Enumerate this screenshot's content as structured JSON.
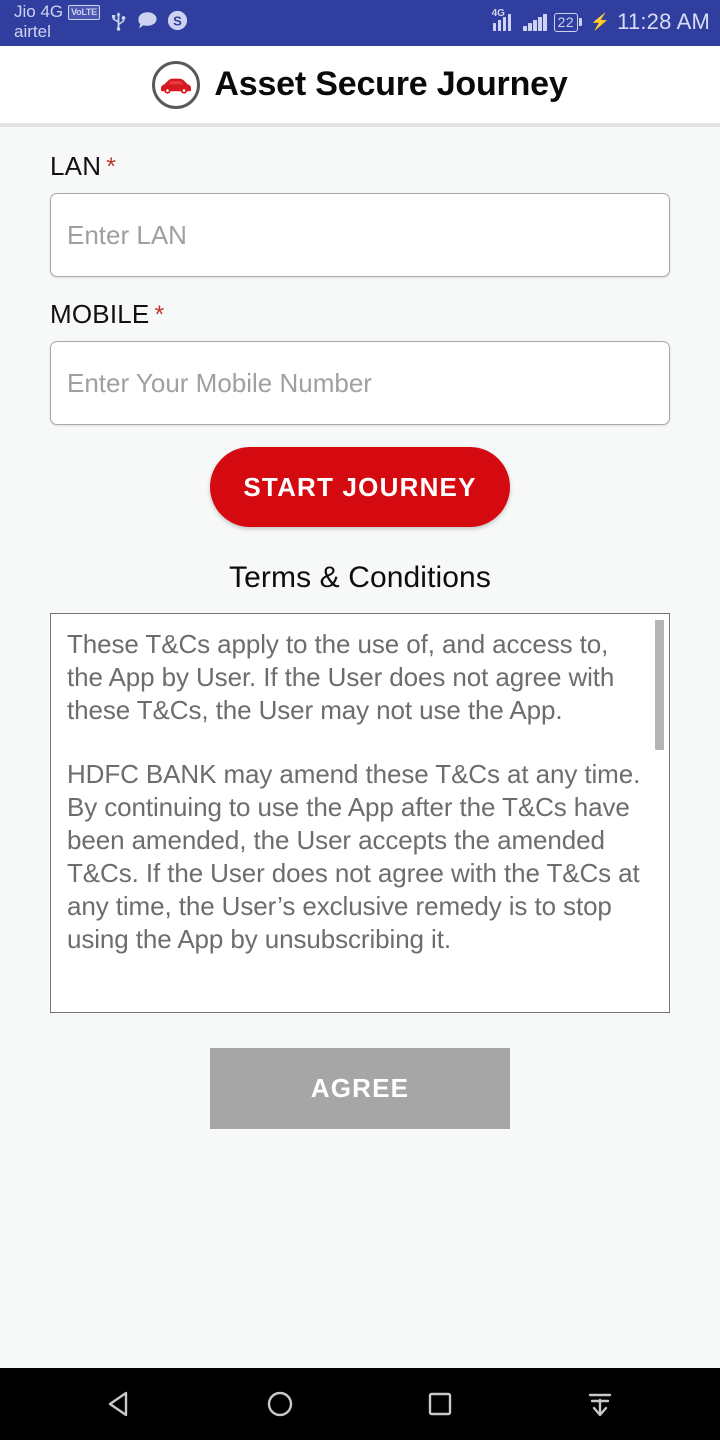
{
  "status_bar": {
    "carrier_primary": "Jio 4G",
    "volte_badge": "VoLTE",
    "carrier_secondary": "airtel",
    "network_label": "4G",
    "battery_percent": "22",
    "charging_glyph": "⚡",
    "time": "11:28 AM",
    "icons": [
      "usb-icon",
      "message-icon",
      "skype-icon",
      "signal-4g-icon",
      "signal-icon",
      "battery-icon",
      "charging-bolt-icon"
    ],
    "background_color": "#303F9F"
  },
  "header": {
    "title": "Asset Secure Journey",
    "logo": "car-circle-logo",
    "background_color": "#FFFFFF"
  },
  "form": {
    "lan": {
      "label": "LAN",
      "required_mark": "*",
      "placeholder": "Enter LAN",
      "value": ""
    },
    "mobile": {
      "label": "MOBILE",
      "required_mark": "*",
      "placeholder": "Enter Your Mobile Number",
      "value": ""
    },
    "start_button": {
      "label": "START JOURNEY",
      "color": "#D50A11"
    }
  },
  "terms": {
    "title": "Terms & Conditions",
    "paragraphs": [
      "These T&Cs apply to the use of, and access to, the App by User. If the User does not agree with these T&Cs, the User may not use the App.",
      " HDFC BANK may amend these T&Cs at any time. By continuing to use the App after the T&Cs have been amended, the User accepts the amended T&Cs. If the User does not agree with the T&Cs at any time, the User’s exclusive remedy is to stop using the App by unsubscribing it."
    ],
    "agree_button": {
      "label": "AGREE",
      "color": "#A6A6A6",
      "state": "disabled"
    }
  },
  "nav_bar": {
    "items": [
      {
        "name": "back-icon"
      },
      {
        "name": "home-icon"
      },
      {
        "name": "recents-icon"
      },
      {
        "name": "hide-navbar-icon"
      }
    ],
    "background_color": "#000000"
  }
}
